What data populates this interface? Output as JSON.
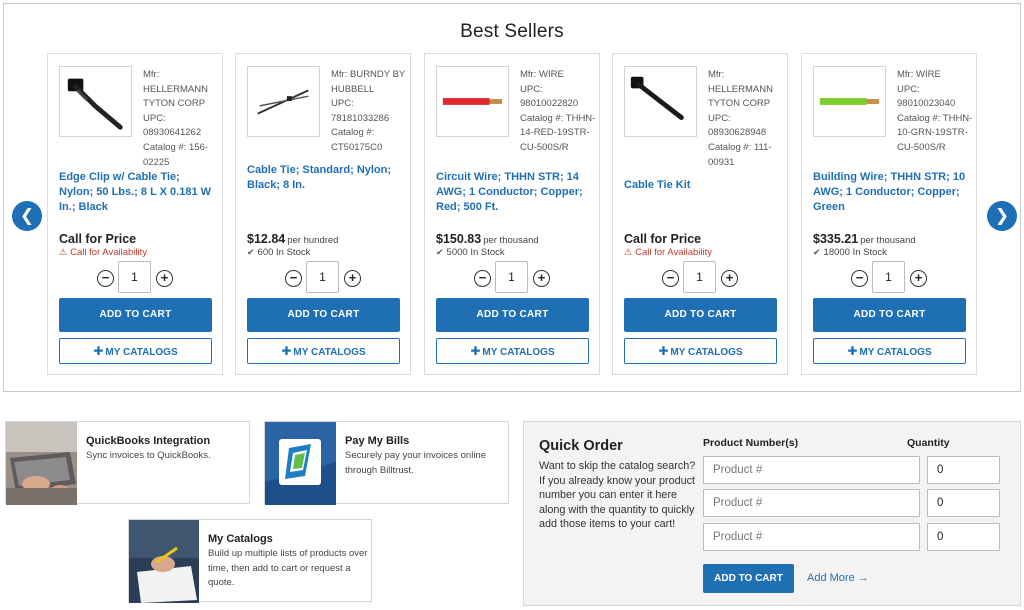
{
  "best_sellers": {
    "title": "Best Sellers",
    "prev_arrow": "❮",
    "next_arrow": "❯",
    "products": [
      {
        "mfr_label": "Mfr: HELLERMANN TYTON CORP",
        "upc_label": "UPC: 08930641262",
        "catalog_label": "Catalog #: 156-02225",
        "name": "Edge Clip w/ Cable Tie; Nylon; 50 Lbs.; 8 L X 0.181 W In.; Black",
        "price": "Call for Price",
        "unit": "",
        "stock": "Call for Availability",
        "stock_type": "call",
        "qty": "1",
        "add_label": "ADD TO CART",
        "catalogs_label": "MY CATALOGS",
        "thumb_icon": "edge-clip-icon"
      },
      {
        "mfr_label": "Mfr: BURNDY BY HUBBELL",
        "upc_label": "UPC: 78181033286",
        "catalog_label": "Catalog #: CT50175C0",
        "name": "Cable Tie; Standard; Nylon; Black; 8 In.",
        "price": "$12.84",
        "unit": "per hundred",
        "stock": "600 In Stock",
        "stock_type": "in",
        "qty": "1",
        "add_label": "ADD TO CART",
        "catalogs_label": "MY CATALOGS",
        "thumb_icon": "cable-tie-icon"
      },
      {
        "mfr_label": "Mfr: WIRE",
        "upc_label": "UPC: 98010022820",
        "catalog_label": "Catalog #: THHN-14-RED-19STR-CU-500S/R",
        "name": "Circuit Wire; THHN STR; 14 AWG; 1 Conductor; Copper; Red; 500 Ft.",
        "price": "$150.83",
        "unit": "per thousand",
        "stock": "5000 In Stock",
        "stock_type": "in",
        "qty": "1",
        "add_label": "ADD TO CART",
        "catalogs_label": "MY CATALOGS",
        "thumb_icon": "red-wire-icon"
      },
      {
        "mfr_label": "Mfr: HELLERMANN TYTON CORP",
        "upc_label": "UPC: 08930628948",
        "catalog_label": "Catalog #: 111-00931",
        "name": "Cable Tie Kit",
        "price": "Call for Price",
        "unit": "",
        "stock": "Call for Availability",
        "stock_type": "call",
        "qty": "1",
        "add_label": "ADD TO CART",
        "catalogs_label": "MY CATALOGS",
        "thumb_icon": "cable-tie-kit-icon"
      },
      {
        "mfr_label": "Mfr: WIRE",
        "upc_label": "UPC: 98010023040",
        "catalog_label": "Catalog #: THHN-10-GRN-19STR-CU-500S/R",
        "name": "Building Wire; THHN STR; 10 AWG; 1 Conductor; Copper; Green",
        "price": "$335.21",
        "unit": "per thousand",
        "stock": "18000 In Stock",
        "stock_type": "in",
        "qty": "1",
        "add_label": "ADD TO CART",
        "catalogs_label": "MY CATALOGS",
        "thumb_icon": "green-wire-icon"
      }
    ]
  },
  "promos": {
    "quickbooks": {
      "title": "QuickBooks Integration",
      "desc": "Sync invoices to QuickBooks."
    },
    "paybills": {
      "title": "Pay My Bills",
      "desc": "Securely pay your invoices online through Billtrust."
    },
    "catalogs": {
      "title": "My Catalogs",
      "desc": "Build up multiple lists of products over time, then add to cart or request a quote."
    }
  },
  "quick_order": {
    "title": "Quick Order",
    "desc": "Want to skip the catalog search? If you already know your product number you can enter it here along with the quantity to quickly add those items to your cart!",
    "col_product": "Product Number(s)",
    "col_qty": "Quantity",
    "rows": [
      {
        "placeholder": "Product #",
        "qty": "0"
      },
      {
        "placeholder": "Product #",
        "qty": "0"
      },
      {
        "placeholder": "Product #",
        "qty": "0"
      }
    ],
    "add_label": "ADD TO CART",
    "more_label": "Add More →"
  },
  "colors": {
    "primary": "#1f6fb5",
    "warning": "#c0392b"
  }
}
